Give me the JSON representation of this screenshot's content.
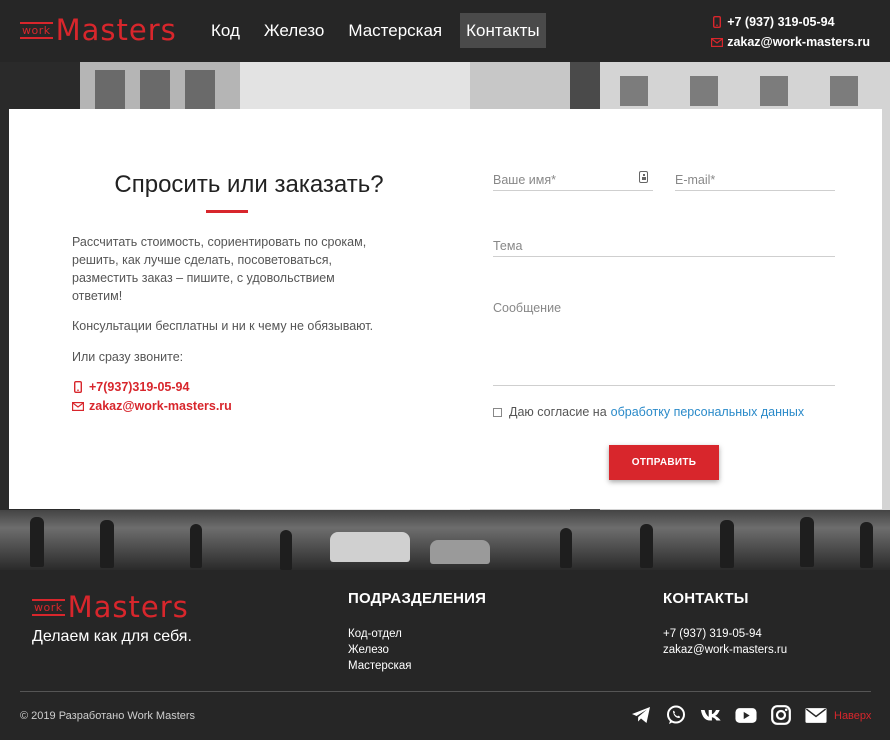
{
  "header": {
    "logo": {
      "small": "work",
      "big": "Masters"
    },
    "nav": [
      {
        "label": "Код",
        "active": false
      },
      {
        "label": "Железо",
        "active": false
      },
      {
        "label": "Мастерская",
        "active": false
      },
      {
        "label": "Контакты",
        "active": true
      }
    ],
    "phone": "+7 (937) 319-05-94",
    "email": "zakaz@work-masters.ru"
  },
  "contact": {
    "title": "Спросить или заказать?",
    "description": "Рассчитать стоимость, сориентировать по срокам, решить, как лучше сделать, посоветоваться, разместить заказ – пишите, с удовольствием ответим!",
    "free_note": "Консультации бесплатны и ни к чему не обязывают.",
    "call_note": "Или сразу звоните:",
    "phone": "+7(937)319-05-94",
    "email": "zakaz@work-masters.ru"
  },
  "form": {
    "name_placeholder": "Ваше имя*",
    "email_placeholder": "E-mail*",
    "subject_placeholder": "Тема",
    "message_placeholder": "Сообщение",
    "consent_text": "Даю согласие на",
    "consent_link": "обработку персональных данных",
    "submit_label": "ОТПРАВИТЬ"
  },
  "footer": {
    "logo": {
      "small": "work",
      "big": "Masters"
    },
    "tagline": "Делаем как для себя.",
    "divisions_title": "ПОДРАЗДЕЛЕНИЯ",
    "divisions": [
      "Код-отдел",
      "Железо",
      "Мастерская"
    ],
    "contacts_title": "КОНТАКТЫ",
    "contacts": [
      "+7 (937) 319-05-94",
      "zakaz@work-masters.ru"
    ],
    "copyright": "© 2019 Разработано Work Masters",
    "socials": [
      "telegram-icon",
      "whatsapp-icon",
      "vk-icon",
      "youtube-icon",
      "instagram-icon",
      "mail-icon"
    ],
    "to_top": "Наверх"
  },
  "colors": {
    "accent": "#d8262c",
    "dark": "#262626",
    "link": "#2a8ac9"
  }
}
